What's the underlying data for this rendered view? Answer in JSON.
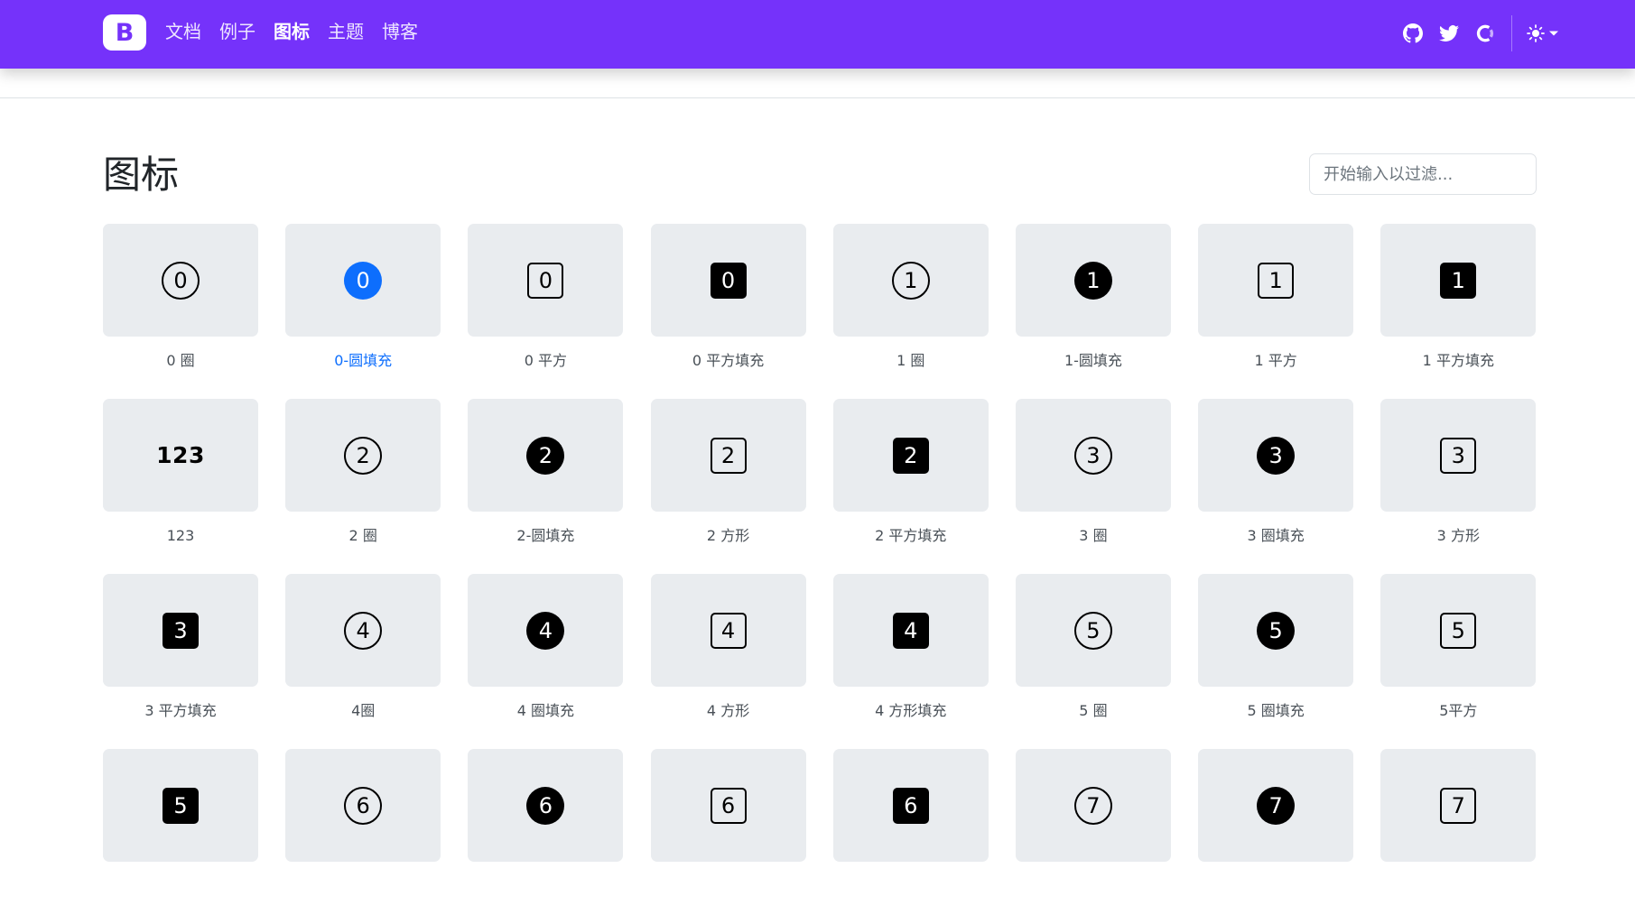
{
  "nav": {
    "brand": "B",
    "links": [
      "文档",
      "例子",
      "图标",
      "主题",
      "博客"
    ],
    "active_index": 2,
    "accent_color": "#7532fa",
    "right_icons": [
      "github-icon",
      "twitter-icon",
      "opencollective-icon"
    ],
    "theme_icon": "sun-icon"
  },
  "page": {
    "title": "图标",
    "filter_placeholder": "开始输入以过滤..."
  },
  "icons": [
    {
      "glyph": "0",
      "style": "circle",
      "label": "0 圈"
    },
    {
      "glyph": "0",
      "style": "circle-fill",
      "label": "0-圆填充",
      "selected": true
    },
    {
      "glyph": "0",
      "style": "square",
      "label": "0 平方"
    },
    {
      "glyph": "0",
      "style": "square-fill",
      "label": "0 平方填充"
    },
    {
      "glyph": "1",
      "style": "circle",
      "label": "1 圈"
    },
    {
      "glyph": "1",
      "style": "circle-fill",
      "label": "1-圆填充"
    },
    {
      "glyph": "1",
      "style": "square",
      "label": "1 平方"
    },
    {
      "glyph": "1",
      "style": "square-fill",
      "label": "1 平方填充"
    },
    {
      "glyph": "123",
      "style": "text",
      "label": "123"
    },
    {
      "glyph": "2",
      "style": "circle",
      "label": "2 圈"
    },
    {
      "glyph": "2",
      "style": "circle-fill",
      "label": "2-圆填充"
    },
    {
      "glyph": "2",
      "style": "square",
      "label": "2 方形"
    },
    {
      "glyph": "2",
      "style": "square-fill",
      "label": "2 平方填充"
    },
    {
      "glyph": "3",
      "style": "circle",
      "label": "3 圈"
    },
    {
      "glyph": "3",
      "style": "circle-fill",
      "label": "3 圈填充"
    },
    {
      "glyph": "3",
      "style": "square",
      "label": "3 方形"
    },
    {
      "glyph": "3",
      "style": "square-fill",
      "label": "3 平方填充"
    },
    {
      "glyph": "4",
      "style": "circle",
      "label": "4圈"
    },
    {
      "glyph": "4",
      "style": "circle-fill",
      "label": "4 圈填充"
    },
    {
      "glyph": "4",
      "style": "square",
      "label": "4 方形"
    },
    {
      "glyph": "4",
      "style": "square-fill",
      "label": "4 方形填充"
    },
    {
      "glyph": "5",
      "style": "circle",
      "label": "5 圈"
    },
    {
      "glyph": "5",
      "style": "circle-fill",
      "label": "5 圈填充"
    },
    {
      "glyph": "5",
      "style": "square",
      "label": "5平方"
    },
    {
      "glyph": "5",
      "style": "square-fill",
      "label": ""
    },
    {
      "glyph": "6",
      "style": "circle",
      "label": ""
    },
    {
      "glyph": "6",
      "style": "circle-fill",
      "label": ""
    },
    {
      "glyph": "6",
      "style": "square",
      "label": ""
    },
    {
      "glyph": "6",
      "style": "square-fill",
      "label": ""
    },
    {
      "glyph": "7",
      "style": "circle",
      "label": ""
    },
    {
      "glyph": "7",
      "style": "circle-fill",
      "label": ""
    },
    {
      "glyph": "7",
      "style": "square",
      "label": ""
    }
  ]
}
